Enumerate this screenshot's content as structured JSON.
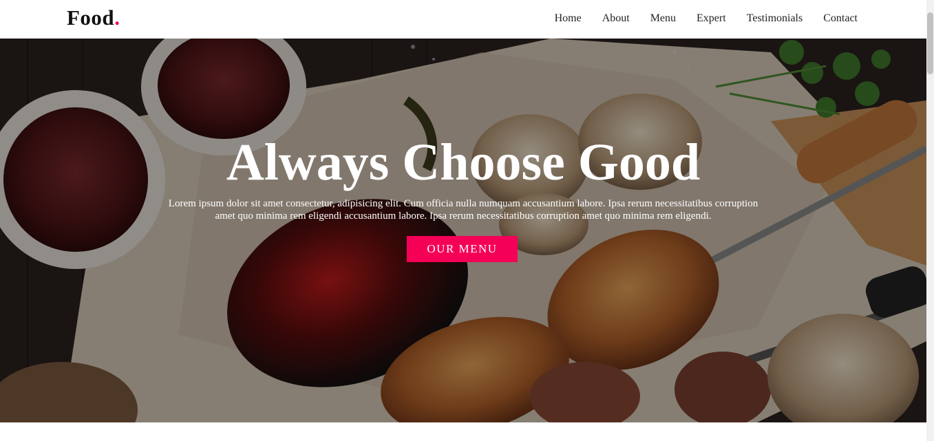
{
  "header": {
    "logo_text": "Food",
    "logo_dot": ".",
    "nav": [
      "Home",
      "About",
      "Menu",
      "Expert",
      "Testimonials",
      "Contact"
    ]
  },
  "hero": {
    "title": "Always Choose Good",
    "text": "Lorem ipsum dolor sit amet consectetur, adipisicing elit. Cum officia nulla numquam accusantium labore. Ipsa rerum necessitatibus corruption amet quo minima rem eligendi accusantium labore. Ipsa rerum necessitatibus corruption amet quo minima rem eligendi.",
    "button_label": "OUR MENU"
  },
  "colors": {
    "accent": "#f50057",
    "text_dark": "#111111"
  },
  "icons": {
    "hero_image": "grilled-food-image"
  }
}
